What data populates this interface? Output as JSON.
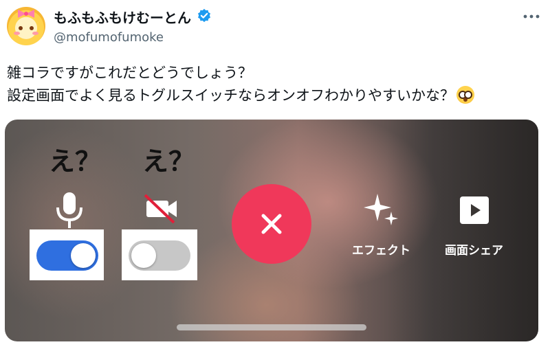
{
  "tweet": {
    "display_name": "もふもふもけむーとん",
    "handle": "@mofumofumoke",
    "text_line1": "雑コラですがこれだとどうでしょう？",
    "text_line2": "設定画面でよく見るトグルスイッチならオンオフわかりやすいかな？",
    "emoji": "flushed-face-emoji",
    "verified_color": "#1d9bf0"
  },
  "media": {
    "annotation_left": "え？",
    "annotation_right": "え？",
    "mic_toggle": {
      "state": "on",
      "accent": "#2f6fe0"
    },
    "camera_toggle": {
      "state": "off",
      "track": "#c7c7c7"
    },
    "end_call_color": "#f0385a",
    "effects_label": "エフェクト",
    "screen_share_label": "画面シェア",
    "icons": [
      "microphone-icon",
      "camera-off-icon",
      "close-icon",
      "sparkles-icon",
      "play-icon"
    ]
  }
}
